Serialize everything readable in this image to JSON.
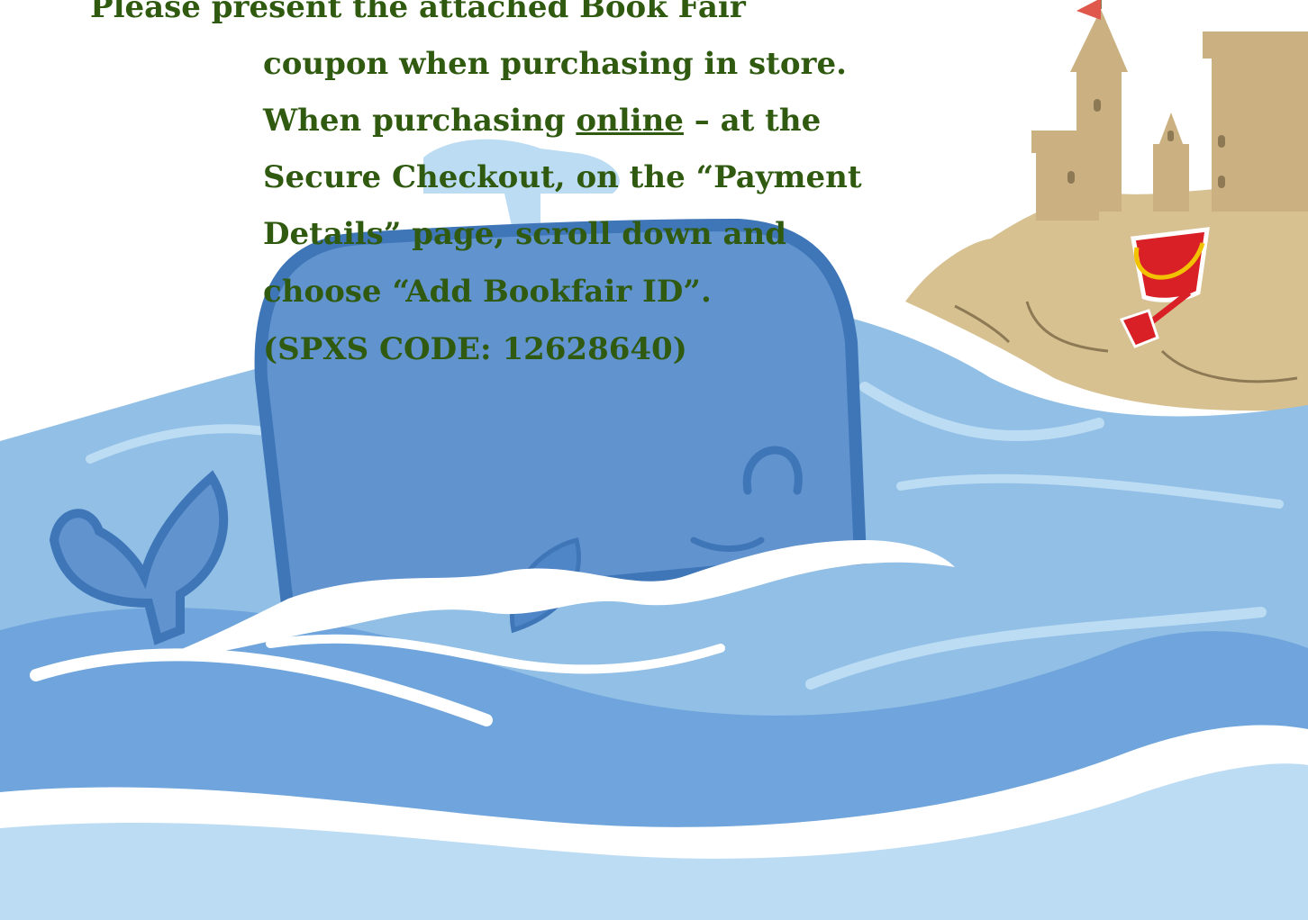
{
  "colors": {
    "text": "#2f5a10",
    "ocean_deep": "#6298d4",
    "ocean_light": "#91bfe6",
    "ocean_pale": "#bcdcf4",
    "whale": "#6193cf",
    "whale_outline": "#3f76b8",
    "sand": "#d7c191",
    "bucket": "#d92027"
  },
  "notice": {
    "line1": "Please present the attached Book Fair",
    "line2": "coupon when purchasing in store.",
    "line3_before": "When purchasing ",
    "line3_link": "online",
    "line3_after": " – at the",
    "line4": "Secure Checkout, on the “Payment",
    "line5": "Details” page, scroll down and",
    "line6": "choose “Add Bookfair ID”.",
    "line7": "(SPXS CODE: 12628640)"
  }
}
